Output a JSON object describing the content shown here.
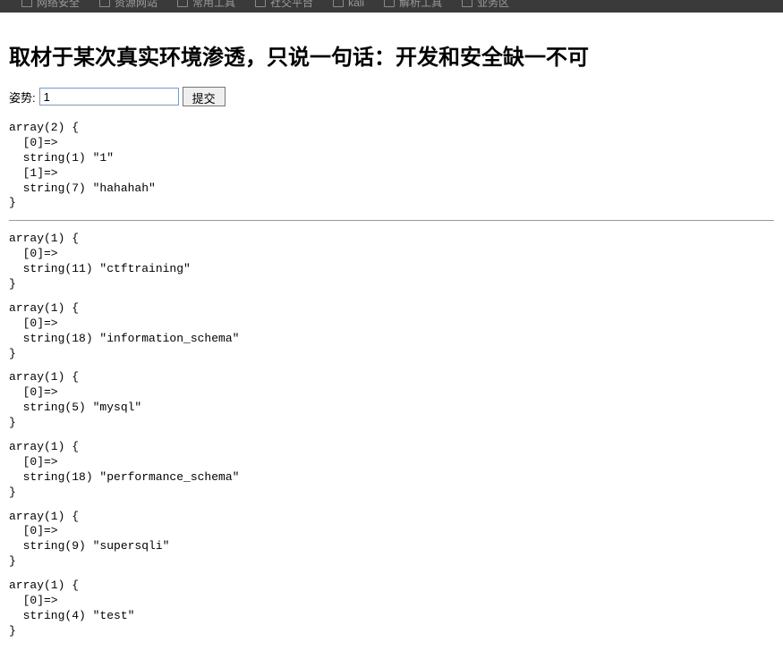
{
  "topbar": {
    "items": [
      {
        "label": "网络安全"
      },
      {
        "label": "资源网站"
      },
      {
        "label": "常用工具"
      },
      {
        "label": "社交平台"
      },
      {
        "label": "kali"
      },
      {
        "label": "解析工具"
      },
      {
        "label": "业务区"
      }
    ]
  },
  "page": {
    "heading": "取材于某次真实环境渗透，只说一句话：开发和安全缺一不可",
    "form_label": "姿势:",
    "input_value": "1",
    "submit_label": "提交"
  },
  "output_blocks": [
    "array(2) {\n  [0]=>\n  string(1) \"1\"\n  [1]=>\n  string(7) \"hahahah\"\n}"
  ],
  "result_blocks": [
    "array(1) {\n  [0]=>\n  string(11) \"ctftraining\"\n}",
    "array(1) {\n  [0]=>\n  string(18) \"information_schema\"\n}",
    "array(1) {\n  [0]=>\n  string(5) \"mysql\"\n}",
    "array(1) {\n  [0]=>\n  string(18) \"performance_schema\"\n}",
    "array(1) {\n  [0]=>\n  string(9) \"supersqli\"\n}",
    "array(1) {\n  [0]=>\n  string(4) \"test\"\n}"
  ]
}
